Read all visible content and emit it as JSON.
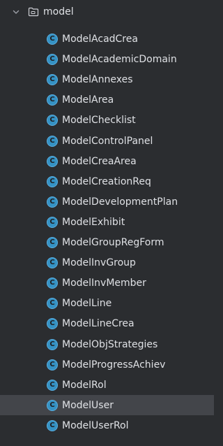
{
  "folder": {
    "name": "model",
    "icon": "folder-icon",
    "expanded_icon": "chevron-down-icon"
  },
  "classes": [
    {
      "label": "ModelAcadCrea"
    },
    {
      "label": "ModelAcademicDomain"
    },
    {
      "label": "ModelAnnexes"
    },
    {
      "label": "ModelArea"
    },
    {
      "label": "ModelChecklist"
    },
    {
      "label": "ModelControlPanel"
    },
    {
      "label": "ModelCreaArea"
    },
    {
      "label": "ModelCreationReq"
    },
    {
      "label": "ModelDevelopmentPlan"
    },
    {
      "label": "ModelExhibit"
    },
    {
      "label": "ModelGroupRegForm"
    },
    {
      "label": "ModelInvGroup"
    },
    {
      "label": "ModelInvMember"
    },
    {
      "label": "ModelLine"
    },
    {
      "label": "ModelLineCrea"
    },
    {
      "label": "ModelObjStrategies"
    },
    {
      "label": "ModelProgressAchiev"
    },
    {
      "label": "ModelRol"
    },
    {
      "label": "ModelUser",
      "selected": true
    },
    {
      "label": "ModelUserRol"
    }
  ],
  "class_icon": {
    "name": "class-icon",
    "letter": "C",
    "color": "#3592c4"
  },
  "colors": {
    "background": "#2b2d30",
    "selection": "#43454a",
    "text": "#dfe1e5"
  }
}
